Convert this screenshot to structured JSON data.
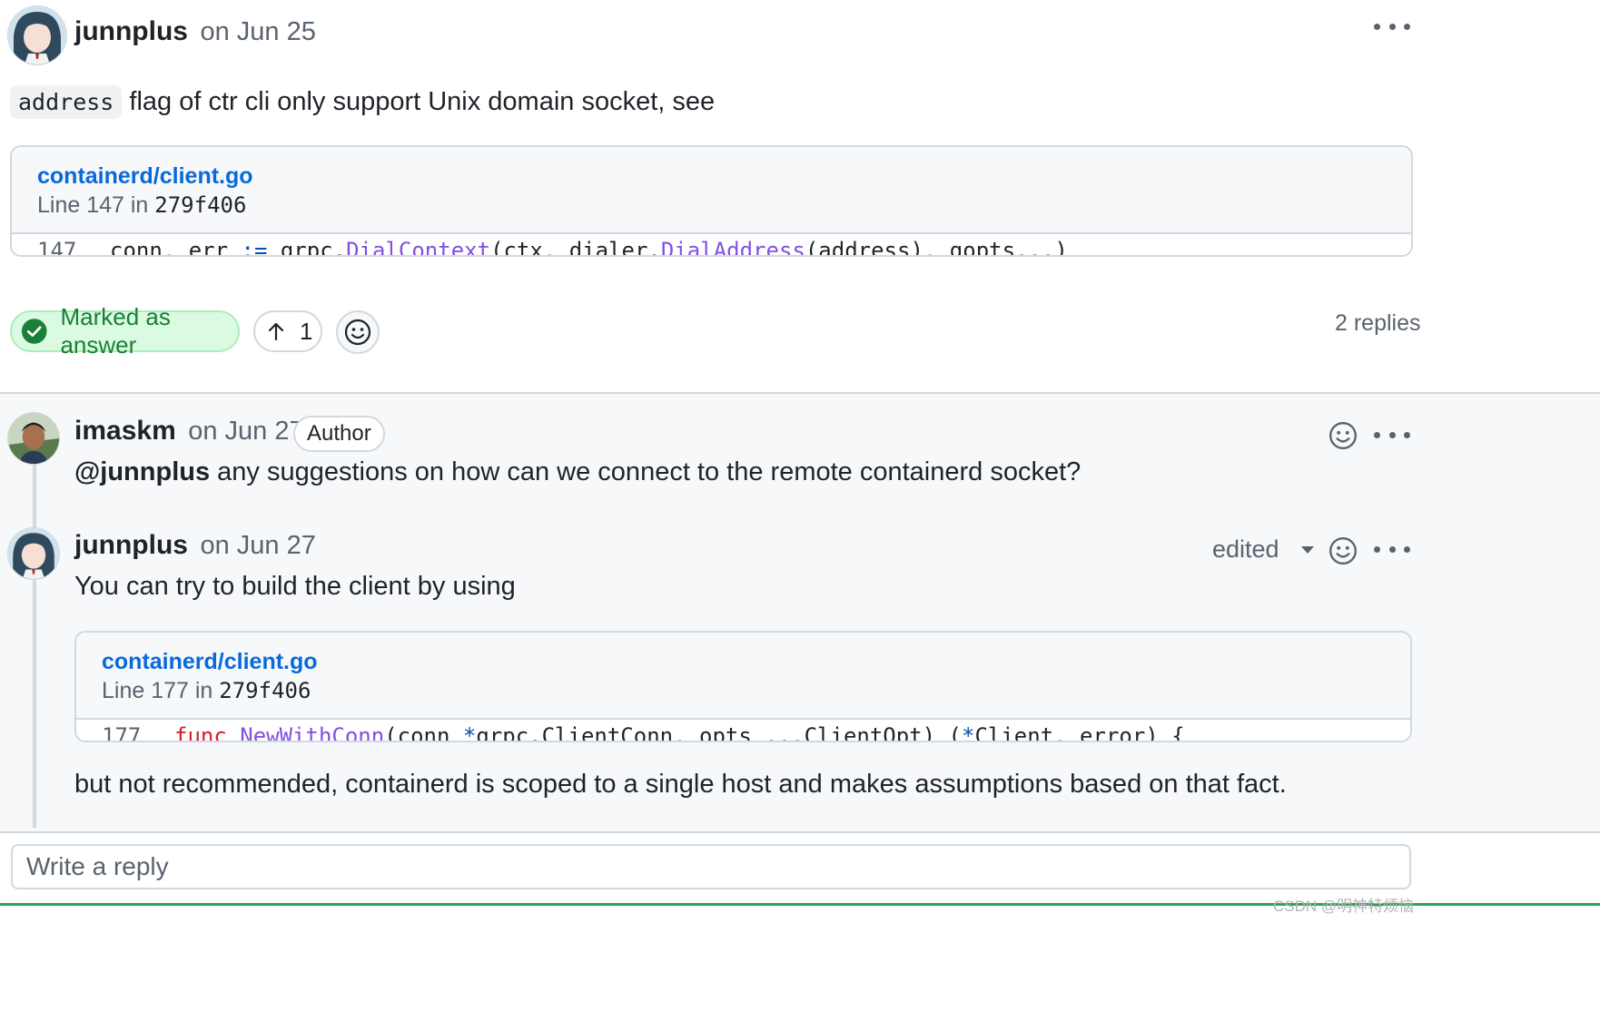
{
  "comment": {
    "username": "junnplus",
    "date": "on Jun 25",
    "code_term": "address",
    "text_after": " flag of ctr cli only support Unix domain socket, see",
    "embed": {
      "file": "containerd/client.go",
      "meta_prefix": "Line 147 in ",
      "commit": "279f406",
      "line_number": "147",
      "code_tokens": [
        {
          "t": "conn, err ",
          "c": ""
        },
        {
          "t": ":=",
          "c": "op"
        },
        {
          "t": " grpc.",
          "c": ""
        },
        {
          "t": "DialContext",
          "c": "fn"
        },
        {
          "t": "(ctx, dialer.",
          "c": ""
        },
        {
          "t": "DialAddress",
          "c": "fn"
        },
        {
          "t": "(address), gopts",
          "c": ""
        },
        {
          "t": "...",
          "c": "op"
        },
        {
          "t": ")",
          "c": ""
        }
      ]
    },
    "answer_label": "Marked as answer",
    "upvote_count": "1",
    "replies_count": "2 replies"
  },
  "replies": [
    {
      "username": "imaskm",
      "date": "on Jun 27",
      "badge": "Author",
      "mention": "@junnplus",
      "text": " any suggestions on how can we connect to the remote containerd socket?"
    },
    {
      "username": "junnplus",
      "date": "on Jun 27",
      "edited_label": "edited",
      "text_before": "You can try to build the client by using",
      "embed": {
        "file": "containerd/client.go",
        "meta_prefix": "Line 177 in ",
        "commit": "279f406",
        "line_number": "177",
        "code_tokens": [
          {
            "t": "func",
            "c": "kw"
          },
          {
            "t": " ",
            "c": ""
          },
          {
            "t": "NewWithConn",
            "c": "fn"
          },
          {
            "t": "(conn ",
            "c": ""
          },
          {
            "t": "*",
            "c": "op"
          },
          {
            "t": "grpc.ClientConn, opts ",
            "c": ""
          },
          {
            "t": "...",
            "c": "op"
          },
          {
            "t": "ClientOpt) (",
            "c": ""
          },
          {
            "t": "*",
            "c": "op"
          },
          {
            "t": "Client, error) {",
            "c": ""
          }
        ]
      },
      "text_after": "but not recommended, containerd is scoped to a single host and makes assumptions based on that fact."
    }
  ],
  "reply_input": {
    "placeholder": "Write a reply",
    "value": ""
  },
  "watermark": "CSDN @明神特烦恼",
  "icons": {
    "kebab": "kebab-horizontal-icon",
    "smile": "smiley-icon",
    "check": "check-circle-fill-icon",
    "arrow_up": "arrow-up-icon",
    "caret": "triangle-down-icon"
  },
  "colors": {
    "link": "#0969da",
    "answer_bg": "#dafbe1",
    "answer_fg": "#1a7f37",
    "code_function": "#8250df",
    "code_keyword": "#cf222e",
    "code_operator": "#0550ae",
    "muted": "#59636e",
    "border": "#d1d9e0"
  }
}
